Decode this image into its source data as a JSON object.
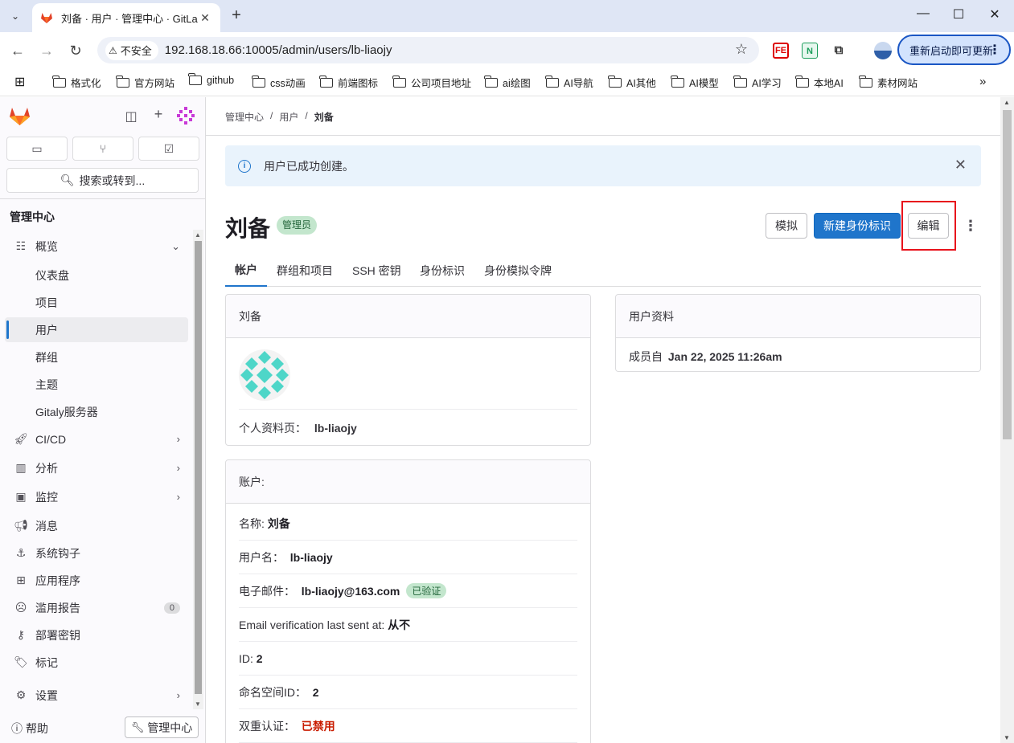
{
  "browser": {
    "tab_title": "刘备 · 用户 · 管理中心 · GitLab",
    "insecure_label": "不安全",
    "url": "192.168.18.66:10005/admin/users/lb-liaojy",
    "restart_label": "重新启动即可更新",
    "bookmarks": [
      "格式化",
      "官方网站",
      "github",
      "css动画",
      "前端图标",
      "公司项目地址",
      "ai绘图",
      "AI导航",
      "AI其他",
      "AI模型",
      "AI学习",
      "本地AI",
      "素材网站"
    ]
  },
  "sidebar": {
    "search_label": "搜索或转到...",
    "section_title": "管理中心",
    "items": [
      {
        "label": "概览",
        "icon": "overview-icon"
      },
      {
        "label": "仪表盘"
      },
      {
        "label": "项目"
      },
      {
        "label": "用户"
      },
      {
        "label": "群组"
      },
      {
        "label": "主题"
      },
      {
        "label": "Gitaly服务器"
      },
      {
        "label": "CI/CD",
        "icon": "rocket-icon"
      },
      {
        "label": "分析",
        "icon": "chart-icon"
      },
      {
        "label": "监控",
        "icon": "monitor-icon"
      },
      {
        "label": "消息",
        "icon": "megaphone-icon"
      },
      {
        "label": "系统钩子",
        "icon": "hook-icon"
      },
      {
        "label": "应用程序",
        "icon": "apps-icon"
      },
      {
        "label": "滥用报告",
        "icon": "abuse-icon",
        "count": "0"
      },
      {
        "label": "部署密钥",
        "icon": "key-icon"
      },
      {
        "label": "标记",
        "icon": "label-icon"
      },
      {
        "label": "设置",
        "icon": "settings-icon"
      }
    ],
    "help_label": "帮助",
    "admin_label": "管理中心"
  },
  "main": {
    "breadcrumb": [
      "管理中心",
      "用户",
      "刘备"
    ],
    "alert": "用户已成功创建。",
    "user_name": "刘备",
    "admin_badge": "管理员",
    "impersonate_label": "模拟",
    "new_identity_label": "新建身份标识",
    "edit_label": "编辑",
    "tabs": [
      "帐户",
      "群组和项目",
      "SSH 密钥",
      "身份标识",
      "身份模拟令牌"
    ],
    "profile_card": {
      "header": "刘备",
      "profile_page_label": "个人资料页：",
      "profile_page_value": "lb-liaojy"
    },
    "info_card": {
      "header": "用户资料",
      "member_since_label": "成员自",
      "member_since_value": "Jan 22, 2025 11:26am"
    },
    "account_card": {
      "header": "账户:",
      "rows": [
        {
          "label": "名称:",
          "value": "刘备"
        },
        {
          "label": "用户名：",
          "value": "lb-liaojy"
        },
        {
          "label": "电子邮件：",
          "value": "lb-liaojy@163.com",
          "badge": "已验证"
        },
        {
          "label": "Email verification last sent at:",
          "value": "从不"
        },
        {
          "label": "ID:",
          "value": "2"
        },
        {
          "label": "命名空间ID：",
          "value": "2"
        },
        {
          "label": "双重认证：",
          "value": "已禁用"
        }
      ]
    }
  },
  "colors": {
    "primary": "#1f75cb",
    "highlight_box": "#e8131c",
    "success_badge_bg": "#c3e6cd",
    "danger_text": "#c91c00"
  }
}
